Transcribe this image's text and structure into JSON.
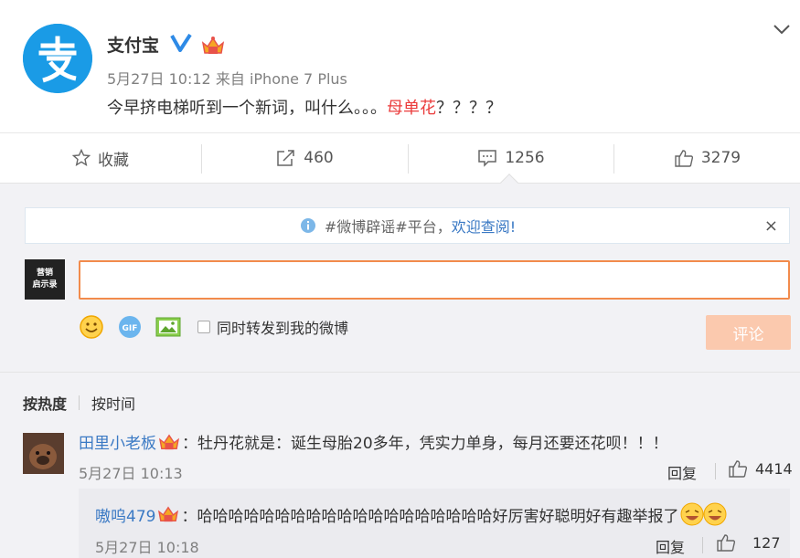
{
  "post": {
    "author": "支付宝",
    "date": "5月27日 10:12",
    "from_prefix": "来自",
    "device": "iPhone 7 Plus",
    "text_before": "今早挤电梯听到一个新词，叫什么。。。",
    "text_highlight": "母单花",
    "text_after": "？？？？",
    "highlight_color": "#eb3c3c",
    "icons": {
      "avatar": "alipay-logo",
      "verified": "verified-v-icon",
      "vip": "vip-crown-icon",
      "menu": "chevron-down-icon"
    }
  },
  "actions": {
    "favorite_label": "收藏",
    "forward_count": "460",
    "comment_count": "1256",
    "like_count": "3279"
  },
  "notice": {
    "text": "#微博辟谣#平台，",
    "link": "欢迎查阅!",
    "close": "×"
  },
  "composer": {
    "avatar_line1": "营销",
    "avatar_line2": "启示录",
    "input_value": "",
    "repost_label": "同时转发到我的微博",
    "submit_label": "评论",
    "submit_color": "#fbc9ae",
    "tools": [
      "emoji-icon",
      "gif-icon",
      "image-icon"
    ]
  },
  "sort": {
    "active": "按热度",
    "other": "按时间"
  },
  "comments": [
    {
      "user": "田里小老板",
      "text": "：牡丹花就是：诞生母胎20多年，凭实力单身，每月还要还花呗！！！",
      "time": "5月27日 10:13",
      "reply": "回复",
      "likes": "4414"
    }
  ],
  "replies": [
    {
      "user": "嗷呜479",
      "text": "：哈哈哈哈哈哈哈哈哈哈哈哈哈哈哈哈哈哈哈好厉害好聪明好有趣举报了",
      "time": "5月27日 10:18",
      "reply": "回复",
      "likes": "127"
    }
  ],
  "colors": {
    "link": "#3a79c4",
    "accent_orange": "#f28b4c",
    "bg_comments": "#f2f2f5"
  }
}
